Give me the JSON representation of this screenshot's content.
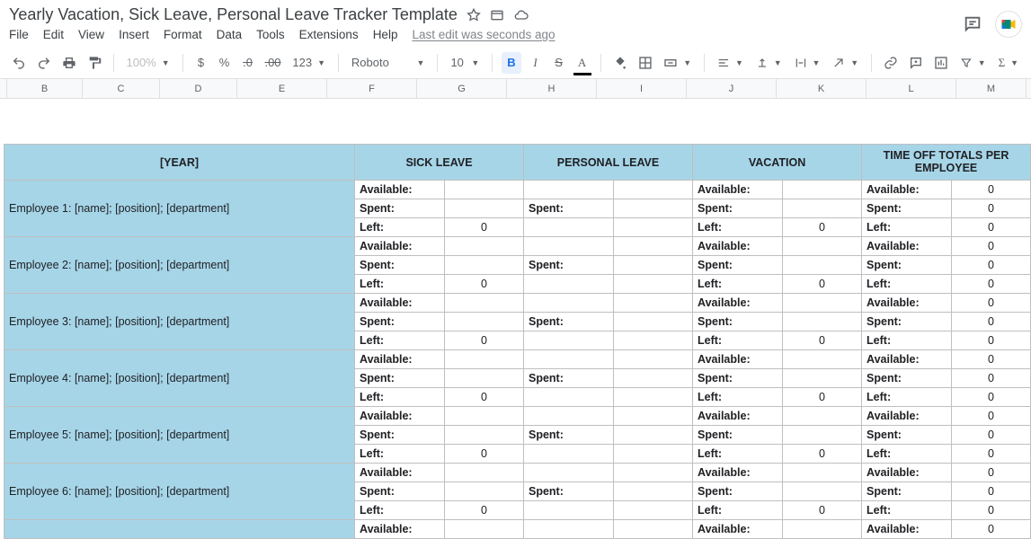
{
  "doc": {
    "title": "Yearly Vacation, Sick Leave, Personal Leave Tracker Template",
    "last_edit": "Last edit was seconds ago"
  },
  "menus": [
    "File",
    "Edit",
    "View",
    "Insert",
    "Format",
    "Data",
    "Tools",
    "Extensions",
    "Help"
  ],
  "toolbar": {
    "zoom": "100%",
    "currency": "$",
    "percent": "%",
    "dec_dec": ".0",
    "inc_dec": ".00",
    "more_formats": "123",
    "font": "Roboto",
    "font_size": "10",
    "bold": "B",
    "italic": "I",
    "strike": "S",
    "text_color": "A"
  },
  "columns": [
    "B",
    "C",
    "D",
    "E",
    "F",
    "G",
    "H",
    "I",
    "J",
    "K",
    "L",
    "M"
  ],
  "headers": {
    "year": "[YEAR]",
    "sick": "SICK LEAVE",
    "personal": "PERSONAL LEAVE",
    "vacation": "VACATION",
    "totals": "TIME OFF TOTALS PER EMPLOYEE"
  },
  "row_labels": {
    "available": "Available:",
    "spent": "Spent:",
    "left": "Left:"
  },
  "employees": [
    {
      "name": "Employee 1: [name]; [position]; [department]",
      "sick_avail": "",
      "sick_spent": "",
      "sick_left": "0",
      "pers_spent": "",
      "vac_avail": "",
      "vac_spent": "",
      "vac_left": "0",
      "tot_avail": "0",
      "tot_spent": "0",
      "tot_left": "0"
    },
    {
      "name": "Employee 2: [name]; [position]; [department]",
      "sick_avail": "",
      "sick_spent": "",
      "sick_left": "0",
      "pers_spent": "",
      "vac_avail": "",
      "vac_spent": "",
      "vac_left": "0",
      "tot_avail": "0",
      "tot_spent": "0",
      "tot_left": "0"
    },
    {
      "name": "Employee 3: [name]; [position]; [department]",
      "sick_avail": "",
      "sick_spent": "",
      "sick_left": "0",
      "pers_spent": "",
      "vac_avail": "",
      "vac_spent": "",
      "vac_left": "0",
      "tot_avail": "0",
      "tot_spent": "0",
      "tot_left": "0"
    },
    {
      "name": "Employee 4: [name]; [position]; [department]",
      "sick_avail": "",
      "sick_spent": "",
      "sick_left": "0",
      "pers_spent": "",
      "vac_avail": "",
      "vac_spent": "",
      "vac_left": "0",
      "tot_avail": "0",
      "tot_spent": "0",
      "tot_left": "0"
    },
    {
      "name": "Employee 5: [name]; [position]; [department]",
      "sick_avail": "",
      "sick_spent": "",
      "sick_left": "0",
      "pers_spent": "",
      "vac_avail": "",
      "vac_spent": "",
      "vac_left": "0",
      "tot_avail": "0",
      "tot_spent": "0",
      "tot_left": "0"
    },
    {
      "name": "Employee 6: [name]; [position]; [department]",
      "sick_avail": "",
      "sick_spent": "",
      "sick_left": "0",
      "pers_spent": "",
      "vac_avail": "",
      "vac_spent": "",
      "vac_left": "0",
      "tot_avail": "0",
      "tot_spent": "0",
      "tot_left": "0"
    }
  ],
  "partial_row_label": "Available:",
  "partial_vac_label": "Available:",
  "partial_tot_label": "Available:",
  "partial_tot_val": "0"
}
